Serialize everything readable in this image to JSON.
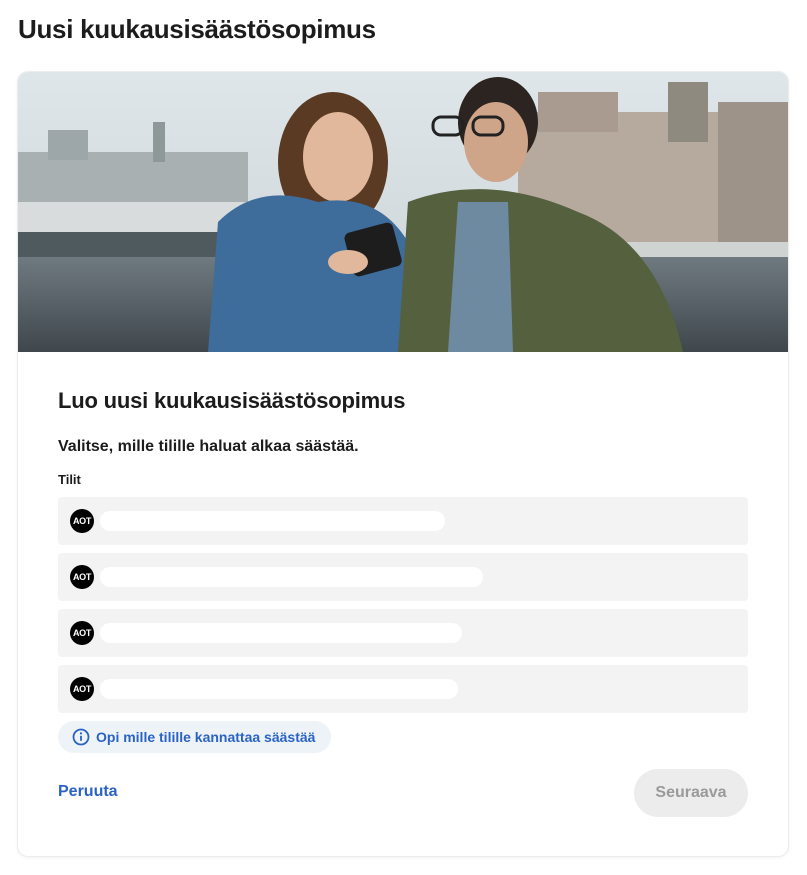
{
  "page": {
    "title": "Uusi kuukausisäästösopimus"
  },
  "hero": {
    "image": "couple-looking-at-phone-photo"
  },
  "form": {
    "heading": "Luo uusi kuukausisäästösopimus",
    "instruction": "Valitse, mille tilille haluat alkaa säästää.",
    "accounts_label": "Tilit",
    "accounts": [
      {
        "badge": "AOT",
        "name_redacted": true
      },
      {
        "badge": "AOT",
        "name_redacted": true
      },
      {
        "badge": "AOT",
        "name_redacted": true
      },
      {
        "badge": "AOT",
        "name_redacted": true
      }
    ],
    "info_link": {
      "label": "Opi mille tilille kannattaa säästää",
      "icon": "info-icon"
    },
    "cancel_label": "Peruuta",
    "next_label": "Seuraava"
  },
  "colors": {
    "link": "#2a63c4",
    "account_row_bg": "#f3f3f3",
    "disabled_button_bg": "#ececec",
    "disabled_button_text": "#9a9a9a"
  }
}
